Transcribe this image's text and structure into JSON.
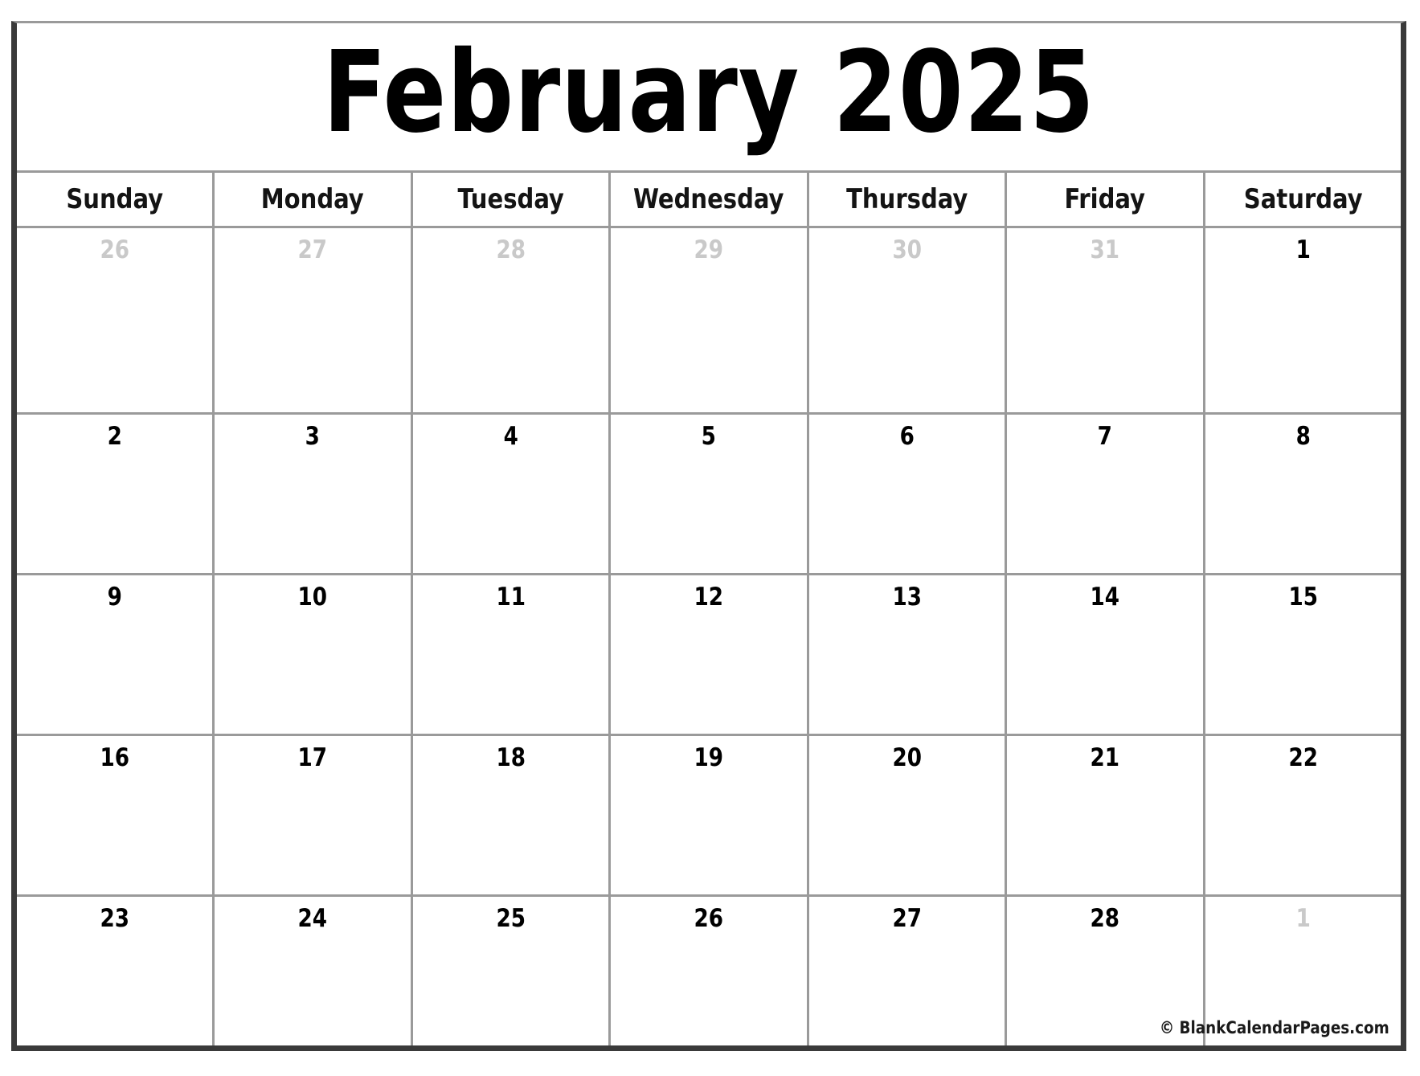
{
  "page": {
    "background_color": "#ffffff",
    "border_color_dark": "#3a3a3a",
    "border_color_light": "#9a9a9a",
    "grid_line_color": "#9a9a9a"
  },
  "header": {
    "title": "February 2025",
    "month": "February",
    "year": "2025",
    "title_color": "#000000"
  },
  "weekday_headers": [
    {
      "label": "Sunday"
    },
    {
      "label": "Monday"
    },
    {
      "label": "Tuesday"
    },
    {
      "label": "Wednesday"
    },
    {
      "label": "Thursday"
    },
    {
      "label": "Friday"
    },
    {
      "label": "Saturday"
    }
  ],
  "colors": {
    "in_month_date": "#000000",
    "out_of_month_date": "#c9c9c9"
  },
  "weeks": [
    {
      "index": 0,
      "days": [
        {
          "number": "26",
          "in_month": false
        },
        {
          "number": "27",
          "in_month": false
        },
        {
          "number": "28",
          "in_month": false
        },
        {
          "number": "29",
          "in_month": false
        },
        {
          "number": "30",
          "in_month": false
        },
        {
          "number": "31",
          "in_month": false
        },
        {
          "number": "1",
          "in_month": true
        }
      ]
    },
    {
      "index": 1,
      "days": [
        {
          "number": "2",
          "in_month": true
        },
        {
          "number": "3",
          "in_month": true
        },
        {
          "number": "4",
          "in_month": true
        },
        {
          "number": "5",
          "in_month": true
        },
        {
          "number": "6",
          "in_month": true
        },
        {
          "number": "7",
          "in_month": true
        },
        {
          "number": "8",
          "in_month": true
        }
      ]
    },
    {
      "index": 2,
      "days": [
        {
          "number": "9",
          "in_month": true
        },
        {
          "number": "10",
          "in_month": true
        },
        {
          "number": "11",
          "in_month": true
        },
        {
          "number": "12",
          "in_month": true
        },
        {
          "number": "13",
          "in_month": true
        },
        {
          "number": "14",
          "in_month": true
        },
        {
          "number": "15",
          "in_month": true
        }
      ]
    },
    {
      "index": 3,
      "days": [
        {
          "number": "16",
          "in_month": true
        },
        {
          "number": "17",
          "in_month": true
        },
        {
          "number": "18",
          "in_month": true
        },
        {
          "number": "19",
          "in_month": true
        },
        {
          "number": "20",
          "in_month": true
        },
        {
          "number": "21",
          "in_month": true
        },
        {
          "number": "22",
          "in_month": true
        }
      ]
    },
    {
      "index": 4,
      "days": [
        {
          "number": "23",
          "in_month": true
        },
        {
          "number": "24",
          "in_month": true
        },
        {
          "number": "25",
          "in_month": true
        },
        {
          "number": "26",
          "in_month": true
        },
        {
          "number": "27",
          "in_month": true
        },
        {
          "number": "28",
          "in_month": true
        },
        {
          "number": "1",
          "in_month": false
        }
      ]
    }
  ],
  "footer": {
    "credit": "© BlankCalendarPages.com"
  }
}
